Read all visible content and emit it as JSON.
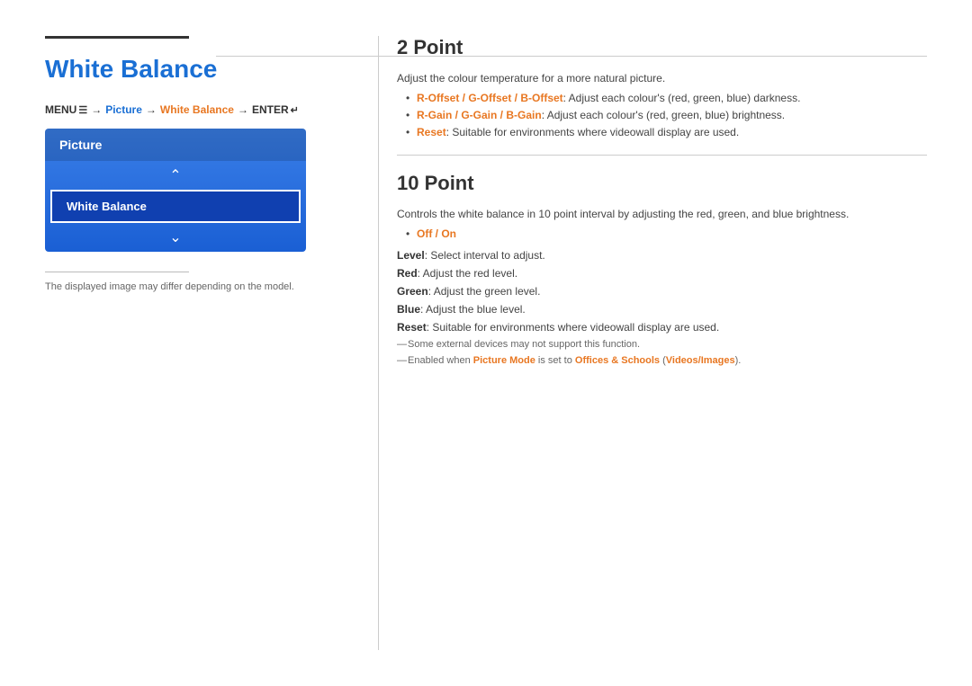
{
  "page": {
    "title": "White Balance",
    "left_divider_color": "#333",
    "menu_path": {
      "menu": "MENU",
      "menu_icon": "☰",
      "arrow1": "→",
      "picture": "Picture",
      "arrow2": "→",
      "white_balance": "White Balance",
      "arrow3": "→",
      "enter": "ENTER",
      "enter_icon": "↵"
    },
    "picture_menu": {
      "header": "Picture",
      "selected": "White Balance"
    },
    "note": "The displayed image may differ depending on the model."
  },
  "sections": {
    "section1": {
      "title": "2 Point",
      "intro": "Adjust the colour temperature for a more natural picture.",
      "bullets": [
        {
          "highlight": "R-Offset / G-Offset / B-Offset",
          "text": ": Adjust each colour's (red, green, blue) darkness."
        },
        {
          "highlight": "R-Gain / G-Gain / B-Gain",
          "text": ": Adjust each colour's (red, green, blue) brightness."
        },
        {
          "highlight": "Reset",
          "text": ": Suitable for environments where videowall display are used."
        }
      ]
    },
    "section2": {
      "title": "10 Point",
      "intro": "Controls the white balance in 10 point interval by adjusting the red, green, and blue brightness.",
      "bullets": [
        {
          "highlight": "Off / On",
          "color": "orange"
        }
      ],
      "details": [
        {
          "label": "Level",
          "text": ": Select interval to adjust."
        },
        {
          "label": "Red",
          "text": ": Adjust the red level."
        },
        {
          "label": "Green",
          "text": ": Adjust the green level."
        },
        {
          "label": "Blue",
          "text": ": Adjust the blue level."
        },
        {
          "label": "Reset",
          "text": ": Suitable for environments where videowall display are used.",
          "label_color": "orange"
        }
      ],
      "notes": [
        "Some external devices may not support this function.",
        {
          "prefix": "Enabled when ",
          "highlight1": "Picture Mode",
          "middle": " is set to ",
          "highlight2": "Offices & Schools",
          "suffix": " (",
          "highlight3": "Videos/Images",
          "end": ")."
        }
      ]
    }
  }
}
